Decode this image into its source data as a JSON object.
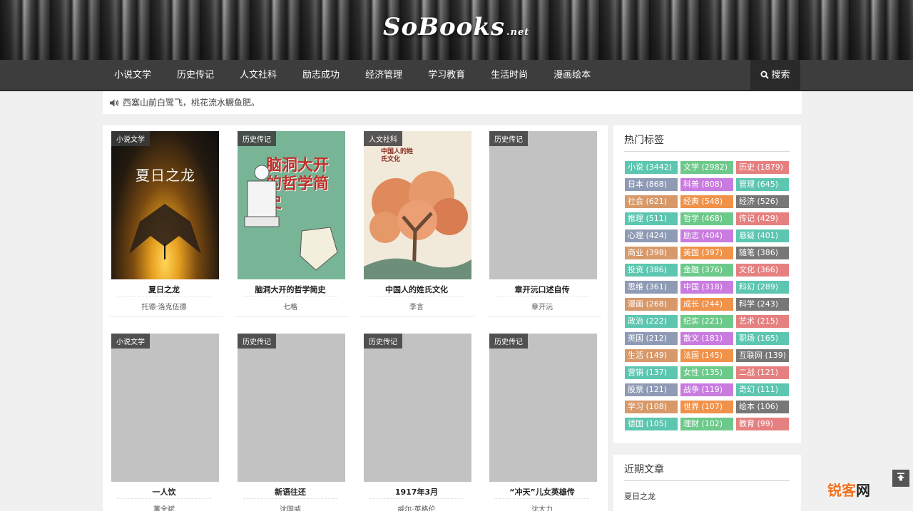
{
  "header": {
    "logo": "SoBooks",
    "logo_suffix": ".net"
  },
  "nav": {
    "items": [
      "小说文学",
      "历史传记",
      "人文社科",
      "励志成功",
      "经济管理",
      "学习教育",
      "生活时尚",
      "漫画绘本"
    ],
    "search_label": "搜索"
  },
  "notice": {
    "text": "西塞山前白鹭飞，桃花流水鳜鱼肥。"
  },
  "books": [
    {
      "category": "小说文学",
      "title": "夏日之龙",
      "author": "托德·洛克伍德",
      "cover_title": "夏日之龙"
    },
    {
      "category": "历史传记",
      "title": "脑洞大开的哲学简史",
      "author": "七格",
      "cover_title": "脑洞大开的哲学简史"
    },
    {
      "category": "人文社科",
      "title": "中国人的姓氏文化",
      "author": "李言",
      "cover_title": "中国人的姓氏文化"
    },
    {
      "category": "历史传记",
      "title": "章开沅口述自传",
      "author": "章开沅"
    },
    {
      "category": "小说文学",
      "title": "一人饮",
      "author": "董全斌"
    },
    {
      "category": "历史传记",
      "title": "新语往还",
      "author": "沈国威"
    },
    {
      "category": "历史传记",
      "title": "1917年3月",
      "author": "威尔·英格伦"
    },
    {
      "category": "历史传记",
      "title": "“冲天”儿女英雄传",
      "author": "沈大力"
    }
  ],
  "sidebar": {
    "tags_title": "热门标签",
    "tags": [
      {
        "label": "小说 (3442)",
        "color": "#5cc6b0"
      },
      {
        "label": "文学 (2982)",
        "color": "#6cc98a"
      },
      {
        "label": "历史 (1879)",
        "color": "#e68080"
      },
      {
        "label": "日本 (868)",
        "color": "#8f9bb5"
      },
      {
        "label": "科普 (808)",
        "color": "#c97be0"
      },
      {
        "label": "管理 (645)",
        "color": "#5cc6b0"
      },
      {
        "label": "社会 (621)",
        "color": "#d8996a"
      },
      {
        "label": "经典 (548)",
        "color": "#f0924a"
      },
      {
        "label": "经济 (526)",
        "color": "#777777"
      },
      {
        "label": "推理 (511)",
        "color": "#5cc6b0"
      },
      {
        "label": "哲学 (468)",
        "color": "#6cc98a"
      },
      {
        "label": "传记 (429)",
        "color": "#e68080"
      },
      {
        "label": "心理 (424)",
        "color": "#8f9bb5"
      },
      {
        "label": "励志 (404)",
        "color": "#c97be0"
      },
      {
        "label": "悬疑 (401)",
        "color": "#5cc6b0"
      },
      {
        "label": "商业 (398)",
        "color": "#d8996a"
      },
      {
        "label": "美国 (397)",
        "color": "#f0924a"
      },
      {
        "label": "随笔 (386)",
        "color": "#777777"
      },
      {
        "label": "投资 (386)",
        "color": "#5cc6b0"
      },
      {
        "label": "金融 (376)",
        "color": "#6cc98a"
      },
      {
        "label": "文化 (366)",
        "color": "#e68080"
      },
      {
        "label": "思维 (361)",
        "color": "#8f9bb5"
      },
      {
        "label": "中国 (318)",
        "color": "#c97be0"
      },
      {
        "label": "科幻 (289)",
        "color": "#5cc6b0"
      },
      {
        "label": "漫画 (268)",
        "color": "#d8996a"
      },
      {
        "label": "成长 (244)",
        "color": "#f0924a"
      },
      {
        "label": "科学 (243)",
        "color": "#777777"
      },
      {
        "label": "政治 (222)",
        "color": "#5cc6b0"
      },
      {
        "label": "纪实 (221)",
        "color": "#6cc98a"
      },
      {
        "label": "艺术 (215)",
        "color": "#e68080"
      },
      {
        "label": "英国 (212)",
        "color": "#8f9bb5"
      },
      {
        "label": "散文 (181)",
        "color": "#c97be0"
      },
      {
        "label": "职场 (165)",
        "color": "#5cc6b0"
      },
      {
        "label": "生活 (149)",
        "color": "#d8996a"
      },
      {
        "label": "法国 (145)",
        "color": "#f0924a"
      },
      {
        "label": "互联网 (139)",
        "color": "#777777"
      },
      {
        "label": "营销 (137)",
        "color": "#5cc6b0"
      },
      {
        "label": "女性 (135)",
        "color": "#6cc98a"
      },
      {
        "label": "二战 (121)",
        "color": "#e68080"
      },
      {
        "label": "股票 (121)",
        "color": "#8f9bb5"
      },
      {
        "label": "战争 (119)",
        "color": "#c97be0"
      },
      {
        "label": "奇幻 (111)",
        "color": "#5cc6b0"
      },
      {
        "label": "学习 (108)",
        "color": "#d8996a"
      },
      {
        "label": "世界 (107)",
        "color": "#f0924a"
      },
      {
        "label": "绘本 (106)",
        "color": "#777777"
      },
      {
        "label": "德国 (105)",
        "color": "#5cc6b0"
      },
      {
        "label": "理财 (102)",
        "color": "#6cc98a"
      },
      {
        "label": "教育 (99)",
        "color": "#e68080"
      }
    ],
    "recent_title": "近期文章",
    "recent": [
      "夏日之龙"
    ]
  },
  "watermark": {
    "part1": "锐客",
    "part2": "网"
  }
}
